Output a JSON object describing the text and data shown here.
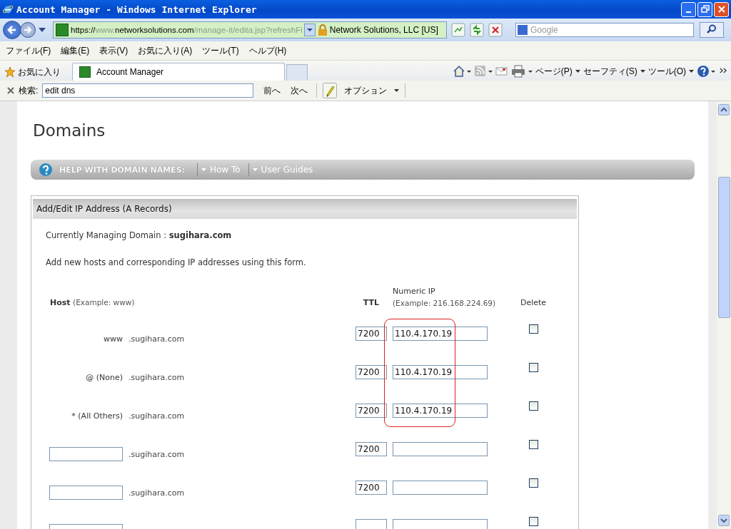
{
  "window": {
    "title": "Account Manager - Windows Internet Explorer"
  },
  "address_bar": {
    "url_parts": [
      {
        "text": "https://",
        "dim": false
      },
      {
        "text": "www.",
        "dim": true
      },
      {
        "text": "networksolutions.com",
        "dim": false
      },
      {
        "text": "/manage-it/edita.jsp?refreshFi",
        "dim": true
      }
    ],
    "certificate": "Network Solutions, LLC [US]",
    "search_placeholder": "Google"
  },
  "menu": [
    "ファイル(F)",
    "編集(E)",
    "表示(V)",
    "お気に入り(A)",
    "ツール(T)",
    "ヘルプ(H)"
  ],
  "favorites": "お気に入り",
  "tabs": [
    {
      "label": "Account Manager",
      "selected": true
    }
  ],
  "command_bar": [
    "ページ(P)",
    "セーフティ(S)",
    "ツール(O)"
  ],
  "find_bar": {
    "label": "検索:",
    "value": "edit dns",
    "prev": "前へ",
    "next": "次へ",
    "options": "オプション"
  },
  "page": {
    "heading": "Domains",
    "help_bar": {
      "label": "HELP WITH DOMAIN NAMES:",
      "links": [
        "How To",
        "User Guides"
      ]
    },
    "panel": {
      "title": "Add/Edit IP Address (A Records)",
      "managing_label": "Currently Managing Domain :",
      "managing_domain": "sugihara.com",
      "intro": "Add new hosts and corresponding IP addresses using this form.",
      "columns": {
        "host": "Host",
        "host_example": "(Example: www)",
        "ttl": "TTL",
        "ip": "Numeric IP",
        "ip_example": "(Example: 216.168.224.69)",
        "delete": "Delete"
      },
      "rows": [
        {
          "kind": "fixed",
          "host": "www",
          "domain": ".sugihara.com",
          "ttl": "7200",
          "ip": "110.4.170.19",
          "checked": false
        },
        {
          "kind": "fixed",
          "host": "@ (None)",
          "domain": ".sugihara.com",
          "ttl": "7200",
          "ip": "110.4.170.19",
          "checked": false
        },
        {
          "kind": "fixed",
          "host": "* (All Others)",
          "domain": ".sugihara.com",
          "ttl": "7200",
          "ip": "110.4.170.19",
          "checked": false
        },
        {
          "kind": "input",
          "domain": ".sugihara.com",
          "ttl": "7200",
          "checked": false
        },
        {
          "kind": "input",
          "domain": ".sugihara.com",
          "ttl": "7200",
          "checked": false
        },
        {
          "kind": "input",
          "checked": false
        }
      ]
    }
  }
}
